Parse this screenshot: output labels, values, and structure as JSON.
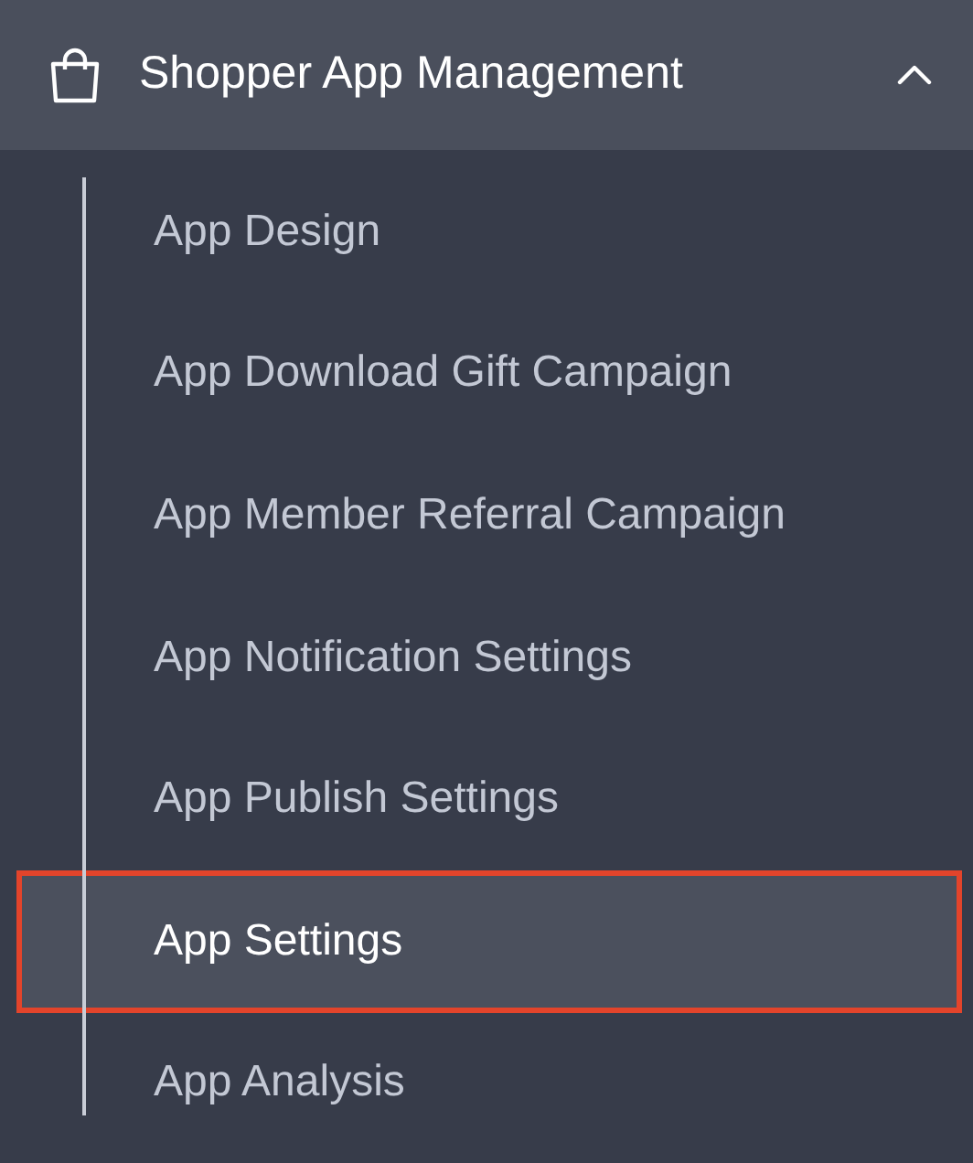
{
  "menu_group": {
    "title": "Shopper App Management",
    "expanded": true,
    "items": [
      {
        "label": "App Design",
        "selected": false
      },
      {
        "label": "App Download Gift Campaign",
        "selected": false
      },
      {
        "label": "App Member Referral Campaign",
        "selected": false
      },
      {
        "label": "App Notification Settings",
        "selected": false
      },
      {
        "label": "App Publish Settings",
        "selected": false
      },
      {
        "label": "App Settings",
        "selected": true
      },
      {
        "label": "App Analysis",
        "selected": false
      }
    ]
  }
}
